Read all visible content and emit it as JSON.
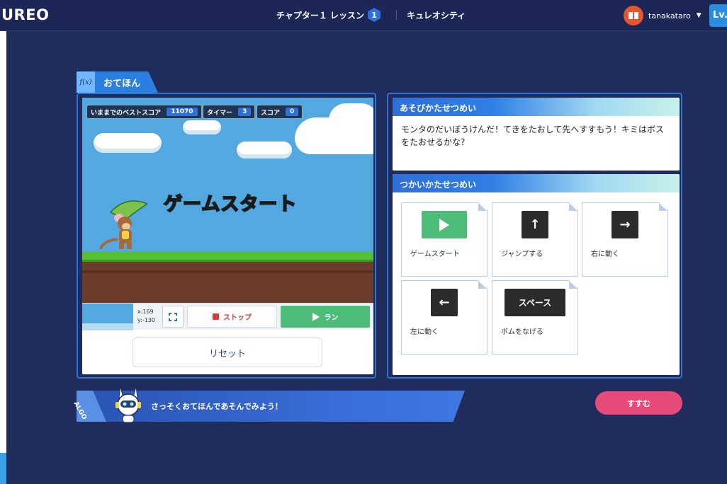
{
  "header": {
    "logo": "UREO",
    "lesson_label": "チャプター１ レッスン",
    "lesson_number": "1",
    "course_name": "キュレオシティ",
    "username": "tanakataro",
    "level_label": "Lv."
  },
  "example": {
    "tab_icon": "f(x)",
    "tab_label": "おてほん",
    "hud": {
      "best_score_label": "いままでのベストスコア",
      "best_score_value": "11070",
      "timer_label": "タイマー",
      "timer_value": "3",
      "score_label": "スコア",
      "score_value": "0"
    },
    "game_title": "ゲームスタート",
    "coords_x": "x:169",
    "coords_y": "y:-130",
    "stop_label": "ストップ",
    "run_label": "ラン",
    "reset_label": "リセット"
  },
  "description": {
    "title": "あそびかたせつめい",
    "text": "モンタのだいぼうけんだ！てきをたおして先へすすもう！キミはボスをたおせるかな？"
  },
  "usage": {
    "title": "つかいかたせつめい",
    "keys": [
      {
        "visual": "play",
        "label": "ゲームスタート"
      },
      {
        "visual": "↑",
        "label": "ジャンプする"
      },
      {
        "visual": "→",
        "label": "右に動く"
      },
      {
        "visual": "←",
        "label": "左に動く"
      },
      {
        "visual": "スペース",
        "label": "ボムをなげる"
      }
    ]
  },
  "assistant": {
    "tag": "ALGO",
    "message": "さっそくおてほんであそんでみよう！"
  },
  "next_button": "すすむ",
  "colors": {
    "background": "#1f2c5c",
    "accent_blue": "#2f6fd8",
    "run_green": "#4cbc78",
    "next_pink": "#e84b7a",
    "stop_red": "#d43c3c"
  }
}
